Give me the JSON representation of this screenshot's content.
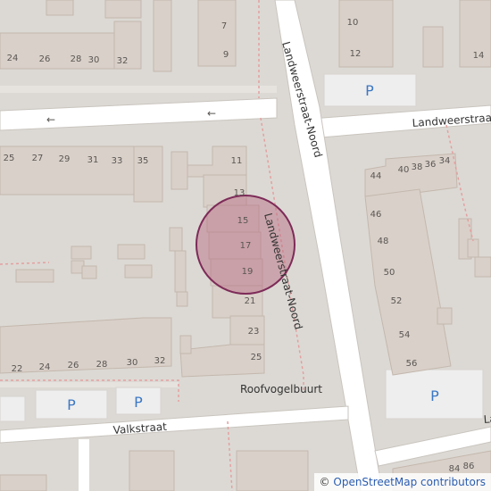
{
  "map": {
    "streets": {
      "landweerstraat_noord": "Landweerstraat-Noord",
      "landweerstraat_east": "Landweerstraat",
      "valkstraat": "Valkstraat",
      "roofvogelbuurt": "Roofvogelbuurt",
      "cut_label_right": "La"
    },
    "house_numbers": {
      "top_row": [
        "24",
        "26",
        "28",
        "30",
        "32"
      ],
      "top_col": [
        "7",
        "9"
      ],
      "top_right": [
        "10",
        "12",
        "14"
      ],
      "odd_left": [
        "25",
        "27",
        "29",
        "31",
        "33",
        "35"
      ],
      "odd_col": [
        "11",
        "13",
        "15",
        "17",
        "19",
        "21",
        "23",
        "25"
      ],
      "right_top": [
        "44",
        "40",
        "38",
        "36",
        "34"
      ],
      "right_col": [
        "46",
        "48",
        "50",
        "52",
        "54",
        "56"
      ],
      "bottom_row": [
        "22",
        "24",
        "26",
        "28",
        "30",
        "32"
      ],
      "bottom_right": [
        "84",
        "86"
      ]
    },
    "parking_label": "P",
    "marker": {
      "center_lat_lon": null,
      "radius_meters": null
    },
    "colors": {
      "background": "#dcd9d4",
      "road": "#ffffff",
      "building": "#d9d0c9",
      "building_stroke": "#c4b8ae",
      "parking_area": "#eeeeee",
      "marker_fill": "#b5667f",
      "marker_stroke": "#7d2b58",
      "admin_boundary": "#e3a0a0"
    },
    "arrows": [
      "←",
      "←"
    ]
  },
  "attribution": {
    "symbol": "©",
    "text": "OpenStreetMap contributors"
  }
}
